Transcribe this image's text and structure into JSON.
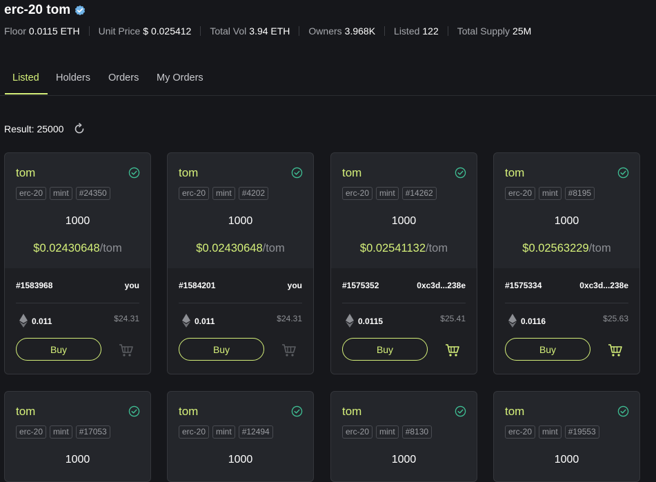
{
  "header": {
    "title": "erc-20 tom",
    "stats": [
      {
        "label": "Floor",
        "value": "0.0115 ETH"
      },
      {
        "label": "Unit Price",
        "value": "$ 0.025412"
      },
      {
        "label": "Total Vol",
        "value": "3.94 ETH"
      },
      {
        "label": "Owners",
        "value": "3.968K"
      },
      {
        "label": "Listed",
        "value": "122"
      },
      {
        "label": "Total Supply",
        "value": "25M"
      }
    ]
  },
  "tabs": [
    "Listed",
    "Holders",
    "Orders",
    "My Orders"
  ],
  "active_tab": "Listed",
  "result": {
    "label": "Result:",
    "count": "25000"
  },
  "colors": {
    "accent": "#d5f07a",
    "background": "#16171b",
    "card": "#24262b",
    "verified": "#6fb3e8",
    "check": "#3fbf94"
  },
  "listings": [
    {
      "name": "tom",
      "tags": [
        "erc-20",
        "mint",
        "#24350"
      ],
      "amount": "1000",
      "price": "$0.02430648",
      "unit": "/tom",
      "listing_id": "#1583968",
      "owner": "you",
      "eth": "0.011",
      "usd": "$24.31",
      "buy_label": "Buy",
      "cart_active": false
    },
    {
      "name": "tom",
      "tags": [
        "erc-20",
        "mint",
        "#4202"
      ],
      "amount": "1000",
      "price": "$0.02430648",
      "unit": "/tom",
      "listing_id": "#1584201",
      "owner": "you",
      "eth": "0.011",
      "usd": "$24.31",
      "buy_label": "Buy",
      "cart_active": false
    },
    {
      "name": "tom",
      "tags": [
        "erc-20",
        "mint",
        "#14262"
      ],
      "amount": "1000",
      "price": "$0.02541132",
      "unit": "/tom",
      "listing_id": "#1575352",
      "owner": "0xc3d...238e",
      "eth": "0.0115",
      "usd": "$25.41",
      "buy_label": "Buy",
      "cart_active": true
    },
    {
      "name": "tom",
      "tags": [
        "erc-20",
        "mint",
        "#8195"
      ],
      "amount": "1000",
      "price": "$0.02563229",
      "unit": "/tom",
      "listing_id": "#1575334",
      "owner": "0xc3d...238e",
      "eth": "0.0116",
      "usd": "$25.63",
      "buy_label": "Buy",
      "cart_active": true
    },
    {
      "name": "tom",
      "tags": [
        "erc-20",
        "mint",
        "#17053"
      ],
      "amount": "1000"
    },
    {
      "name": "tom",
      "tags": [
        "erc-20",
        "mint",
        "#12494"
      ],
      "amount": "1000"
    },
    {
      "name": "tom",
      "tags": [
        "erc-20",
        "mint",
        "#8130"
      ],
      "amount": "1000"
    },
    {
      "name": "tom",
      "tags": [
        "erc-20",
        "mint",
        "#19553"
      ],
      "amount": "1000"
    }
  ]
}
